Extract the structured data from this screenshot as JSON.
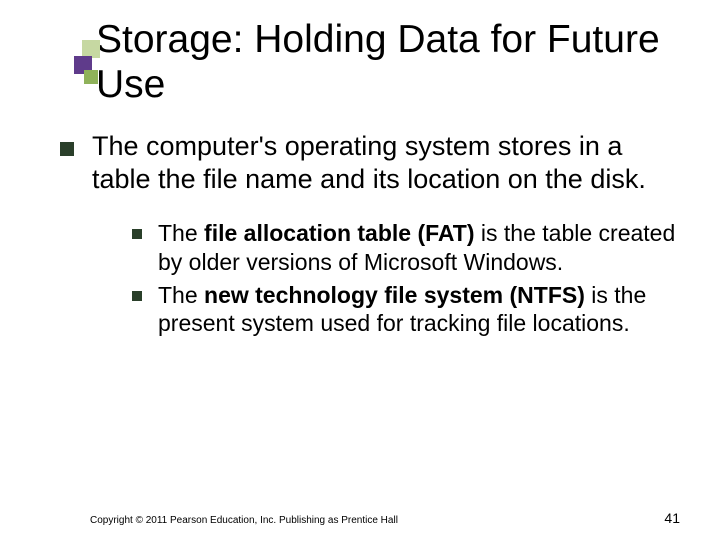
{
  "title": "Storage: Holding Data for Future Use",
  "main_bullet": "The computer's operating system stores in a table the file name and its location on the disk.",
  "sub_bullets": [
    {
      "pre": "The ",
      "bold": "file allocation table (FAT)",
      "post": " is the table created by older versions of Microsoft Windows."
    },
    {
      "pre": "The ",
      "bold": "new technology file system (NTFS)",
      "post": " is the present system used for tracking file locations."
    }
  ],
  "copyright": "Copyright © 2011 Pearson Education, Inc. Publishing as Prentice Hall",
  "page_number": "41"
}
